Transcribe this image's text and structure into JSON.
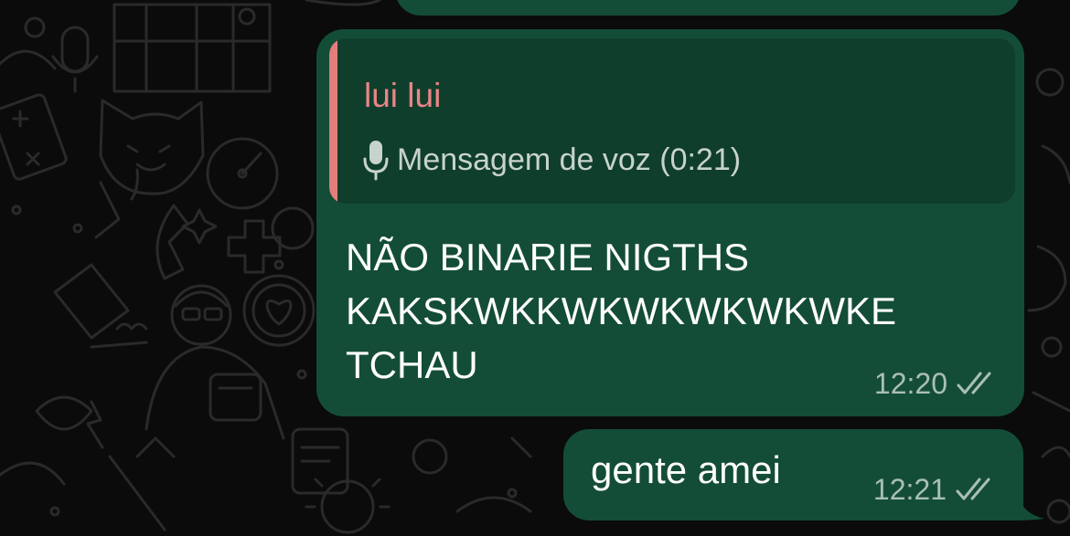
{
  "theme": {
    "background": "#0b0b0b",
    "bubble_outgoing": "#144d37",
    "quote_background": "#103e2c",
    "quote_accent": "#e47d7c",
    "quote_author_color": "#ea8587",
    "meta_color": "#a9c0b4"
  },
  "messages": [
    {
      "reply": {
        "author": "lui lui",
        "icon": "mic-icon",
        "preview": "Mensagem de voz (0:21)"
      },
      "text": "NÃO BINARIE NIGTHS\nKAKSKWKKWKWKWKWKWKE\nTCHAU",
      "time": "12:20",
      "status": "read",
      "status_icon": "double-check-icon"
    },
    {
      "text": "gente amei",
      "time": "12:21",
      "status": "read",
      "status_icon": "double-check-icon"
    }
  ]
}
